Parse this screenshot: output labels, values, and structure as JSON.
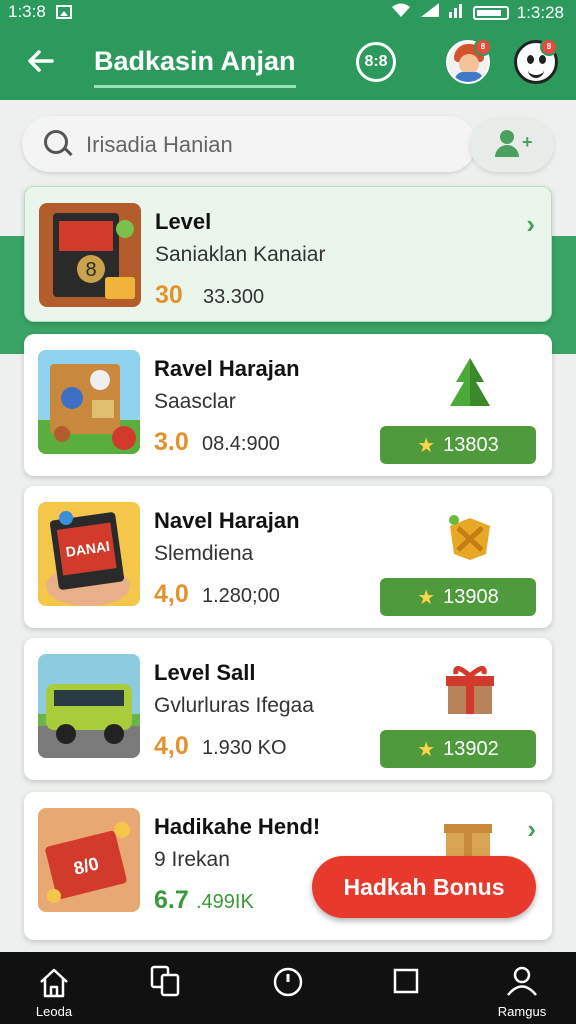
{
  "status_bar": {
    "time_left": "1:3:8",
    "time_right": "1:3:28"
  },
  "app_bar": {
    "title": "Badkasin Anjan",
    "scan_label": "8:8",
    "badge1": "8",
    "badge2": "8"
  },
  "search": {
    "placeholder": "Irisadia Hanian"
  },
  "cards": [
    {
      "title": "Level",
      "subtitle": "Saniaklan Kanaiar",
      "rating": "30",
      "count": "33.300",
      "thumb_text": "8"
    },
    {
      "title": "Ravel Harajan",
      "subtitle": "Saasclar",
      "rating": "3.0",
      "count": "08.4:900",
      "points": "13803"
    },
    {
      "title": "Navel Harajan",
      "subtitle": "Slemdiena",
      "rating": "4,0",
      "count": "1.280;00",
      "points": "13908",
      "thumb_text": "DANAI"
    },
    {
      "title": "Level Sall",
      "subtitle": "Gvlurluras Ifegaa",
      "rating": "4,0",
      "count": "1.930 KO",
      "points": "13902"
    },
    {
      "title": "Hadikahe Hend!",
      "subtitle": "9 Irekan",
      "rating": "6.7",
      "count": ".499IK",
      "thumb_text": "8/0"
    }
  ],
  "bonus_button": "Hadkah Bonus",
  "bottom_nav": [
    {
      "label": "Leoda"
    },
    {
      "label": ""
    },
    {
      "label": ""
    },
    {
      "label": ""
    },
    {
      "label": "Ramgus"
    }
  ],
  "colors": {
    "primary": "#2c9a5d",
    "points_button": "#4e9a3c",
    "bonus": "#e83a2c",
    "rating": "#e3922c"
  }
}
